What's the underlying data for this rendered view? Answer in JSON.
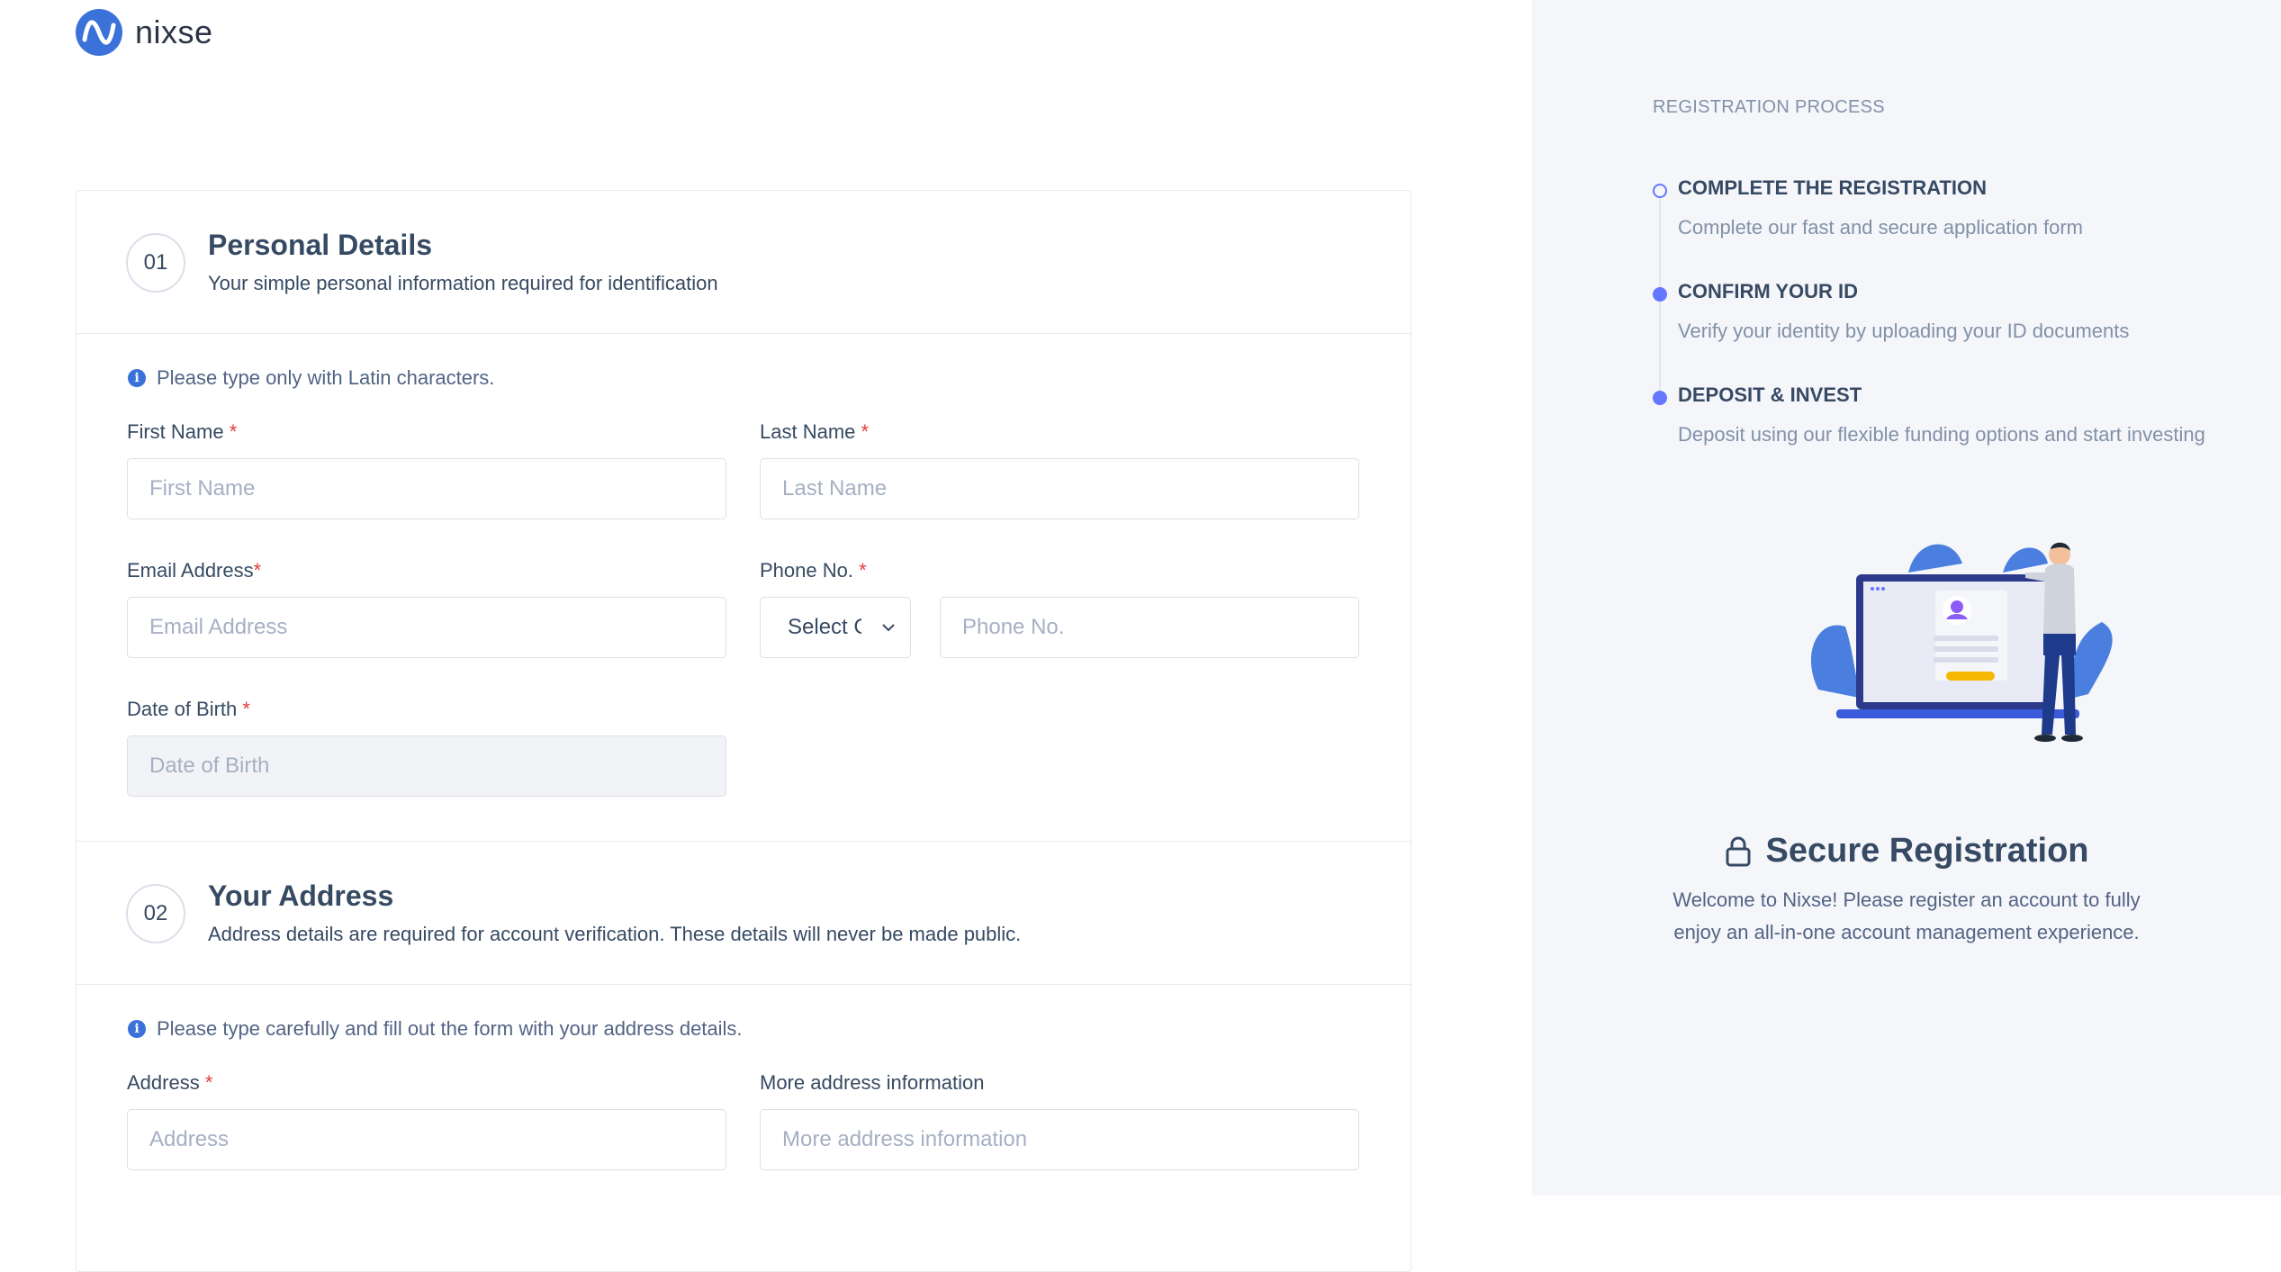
{
  "brand": {
    "name": "nixse",
    "color": "#3b72d9"
  },
  "personal": {
    "step": "01",
    "title": "Personal Details",
    "subtitle": "Your simple personal information required for identification",
    "notice": "Please type only with Latin characters.",
    "first_name": {
      "label": "First Name",
      "required": "*",
      "placeholder": "First Name"
    },
    "last_name": {
      "label": "Last Name",
      "required": "*",
      "placeholder": "Last Name"
    },
    "email": {
      "label": "Email Address",
      "required": "*",
      "placeholder": "Email Address"
    },
    "phone": {
      "label": "Phone No.",
      "required": "*",
      "country_select": "Select Country",
      "placeholder": "Phone No."
    },
    "dob": {
      "label": "Date of Birth",
      "required": "*",
      "placeholder": "Date of Birth"
    }
  },
  "address": {
    "step": "02",
    "title": "Your Address",
    "subtitle": "Address details are required for account verification. These details will never be made public.",
    "notice": "Please type carefully and fill out the form with your address details.",
    "address": {
      "label": "Address",
      "required": "*",
      "placeholder": "Address"
    },
    "more": {
      "label": "More address information",
      "placeholder": "More address information"
    }
  },
  "process": {
    "title": "REGISTRATION PROCESS",
    "steps": [
      {
        "title": "COMPLETE THE REGISTRATION",
        "desc": "Complete our fast and secure application form"
      },
      {
        "title": "CONFIRM YOUR ID",
        "desc": "Verify your identity by uploading your ID documents"
      },
      {
        "title": "DEPOSIT & INVEST",
        "desc": "Deposit using our flexible funding options and start investing"
      }
    ]
  },
  "secure": {
    "title": "Secure Registration",
    "desc": "Welcome to Nixse! Please register an account to fully enjoy an all-in-one account management experience."
  },
  "icons": [
    "logo-icon",
    "info-icon",
    "chevron-down-icon",
    "lock-icon"
  ],
  "accent": "#6576ff"
}
